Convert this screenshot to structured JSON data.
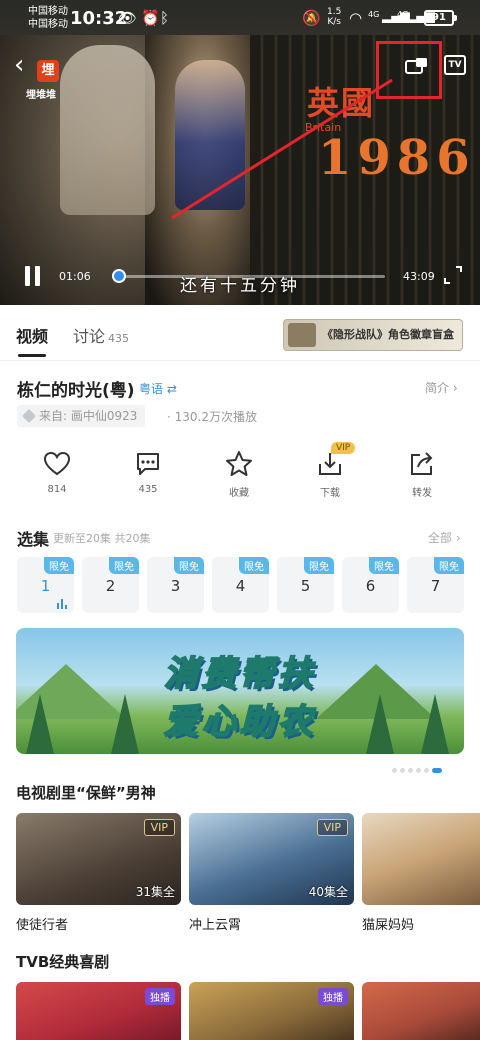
{
  "status_bar": {
    "carrier1": "中国移动",
    "carrier2": "中国移动",
    "time": "10:32",
    "net_speed_value": "1.5",
    "net_speed_unit": "K/s",
    "signal1": "4G",
    "signal2": "4G",
    "battery": "91"
  },
  "player": {
    "channel_logo": "埋",
    "channel_name": "埋堆堆",
    "overlay_country": "英國",
    "overlay_britain": "Britain",
    "overlay_year": "1986",
    "subtitle": "还有十五分钟",
    "current_time": "01:06",
    "total_time": "43:09",
    "progress": 0.025,
    "tv_label": "TV"
  },
  "tabs": {
    "video": "视频",
    "discussion": "讨论",
    "discussion_count": "435",
    "promo": "《隐形战队》角色徽章盲盒"
  },
  "show": {
    "title": "栋仁的时光(粤)",
    "language": "粤语 ⇄",
    "intro": "简介 ›",
    "source": "来自: 画中仙0923",
    "plays": "· 130.2万次播放"
  },
  "actions": [
    {
      "label": "814",
      "icon": "heart-icon"
    },
    {
      "label": "435",
      "icon": "comment-icon"
    },
    {
      "label": "收藏",
      "icon": "star-icon"
    },
    {
      "label": "下载",
      "icon": "download-icon",
      "badge": "VIP"
    },
    {
      "label": "转发",
      "icon": "share-icon"
    }
  ],
  "episodes": {
    "title": "选集",
    "subtitle": "更新至20集 共20集",
    "all": "全部 ›",
    "free_tag": "限免",
    "items": [
      "1",
      "2",
      "3",
      "4",
      "5",
      "6",
      "7"
    ]
  },
  "ad": {
    "line1": "消费帮扶",
    "line2": "爱心助农"
  },
  "section1": {
    "title": "电视剧里“保鲜”男神",
    "cards": [
      {
        "name": "使徒行者",
        "badge": "VIP",
        "episodes": "31集全"
      },
      {
        "name": "冲上云霄",
        "badge": "VIP",
        "episodes": "40集全"
      },
      {
        "name": "猫屎妈妈",
        "badge": "",
        "episodes": ""
      }
    ]
  },
  "section2": {
    "title": "TVB经典喜剧",
    "cards": [
      {
        "badge": "独播"
      },
      {
        "badge": "独播"
      },
      {
        "badge": ""
      }
    ]
  },
  "colors": {
    "accent_blue": "#3a8fe0",
    "annotation_red": "#e3252c",
    "vip_gold": "#f0c04a",
    "free_tag": "#58b8ea"
  }
}
